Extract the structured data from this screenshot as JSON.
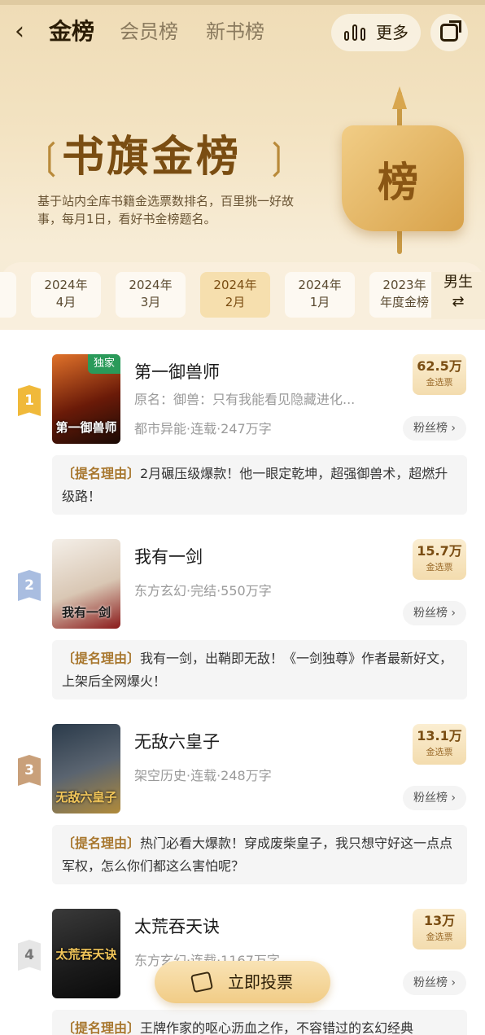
{
  "header": {
    "back_icon": "chevron-left-icon",
    "tabs": [
      "金榜",
      "会员榜",
      "新书榜"
    ],
    "more_label": "更多",
    "more_icon": "bar-chart-icon",
    "share_icon": "share-icon"
  },
  "banner": {
    "title": "书旗金榜",
    "description": "基于站内全库书籍金选票数排名，百里挑一好故事，每月1日，看好书金榜题名。",
    "emblem_text": "榜"
  },
  "months": [
    {
      "year": "2024年",
      "month": "4月"
    },
    {
      "year": "2024年",
      "month": "3月"
    },
    {
      "year": "2024年",
      "month": "2月",
      "selected": true
    },
    {
      "year": "2024年",
      "month": "1月"
    },
    {
      "year": "2023年",
      "month": "年度金榜"
    }
  ],
  "gender": {
    "label": "男生",
    "switch_icon": "swap-icon"
  },
  "books": [
    {
      "rank": "1",
      "cover_title": "第一御兽师",
      "exclusive": "独家",
      "name": "第一御兽师",
      "original": "原名：御兽：只有我能看见隐藏进化...",
      "meta": "都市异能·连载·247万字",
      "votes": "62.5万",
      "votes_label": "金选票",
      "fans": "粉丝榜 ›",
      "reason_tag": "〔提名理由〕",
      "reason": "2月碾压级爆款！他一眼定乾坤，超强御兽术，超燃升级路！"
    },
    {
      "rank": "2",
      "cover_title": "我有一剑",
      "name": "我有一剑",
      "meta": "东方玄幻·完结·550万字",
      "votes": "15.7万",
      "votes_label": "金选票",
      "fans": "粉丝榜 ›",
      "reason_tag": "〔提名理由〕",
      "reason": "我有一剑，出鞘即无敌！《一剑独尊》作者最新好文，上架后全网爆火！"
    },
    {
      "rank": "3",
      "cover_title": "无敌六皇子",
      "name": "无敌六皇子",
      "meta": "架空历史·连载·248万字",
      "votes": "13.1万",
      "votes_label": "金选票",
      "fans": "粉丝榜 ›",
      "reason_tag": "〔提名理由〕",
      "reason": "热门必看大爆款！穿成废柴皇子，我只想守好这一点点军权，怎么你们都这么害怕呢？"
    },
    {
      "rank": "4",
      "cover_title": "太荒吞天诀",
      "name": "太荒吞天诀",
      "meta": "东方玄幻·连载·1167万字",
      "votes": "13万",
      "votes_label": "金选票",
      "fans": "粉丝榜 ›",
      "reason_tag": "〔提名理由〕",
      "reason": "王牌作家的呕心沥血之作，不容错过的玄幻经典"
    }
  ],
  "vote_button": {
    "label": "立即投票",
    "icon": "ticket-icon"
  },
  "colors": {
    "gold": "#7a4d12",
    "rank1": "#f0b93a",
    "rank2": "#a9bde0",
    "rank3": "#c9a07a",
    "rank4": "#e6e6e6"
  }
}
